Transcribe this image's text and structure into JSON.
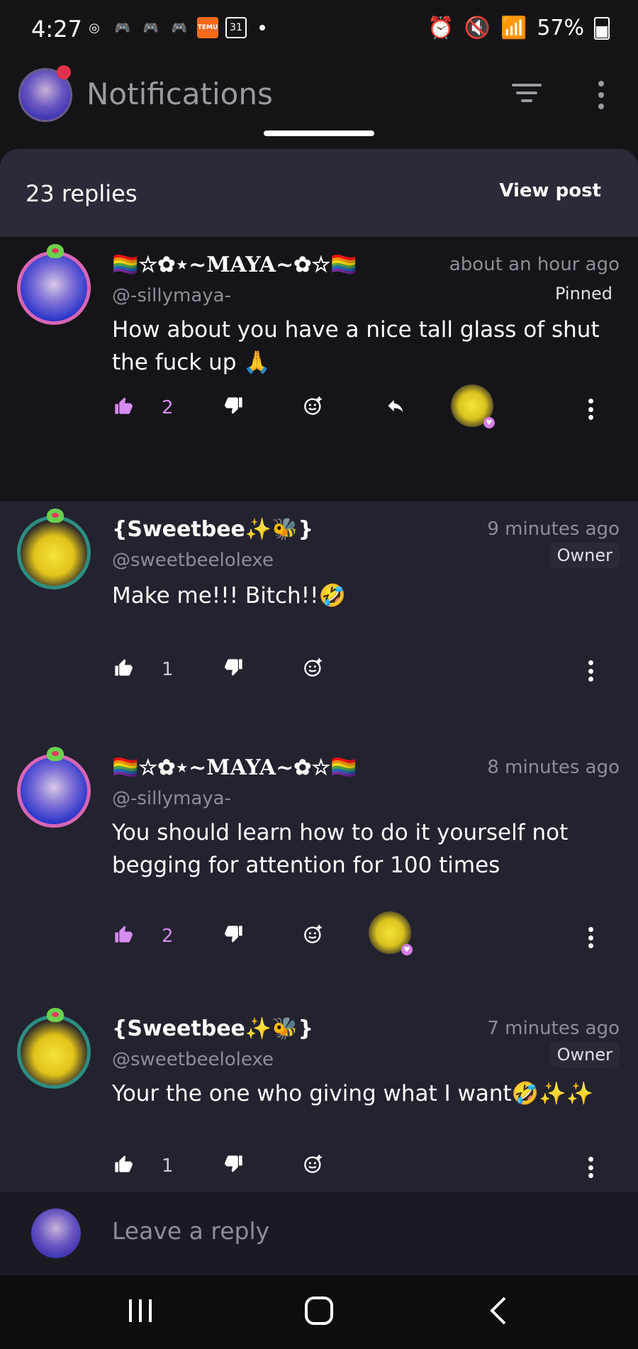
{
  "status_bar": {
    "time": "4:27",
    "battery": "57%",
    "calendar_day": "31",
    "temu_label": "TEMU"
  },
  "app_bar": {
    "title": "Notifications"
  },
  "thread": {
    "replies_count": "23 replies",
    "view_post_label": "View post"
  },
  "comments": [
    {
      "name": "🏳️‍🌈☆✿⋆~MAYA~✿☆🏳️‍🌈",
      "handle": "@-sillymaya-",
      "time": "about an hour ago",
      "tag": "Pinned",
      "text": "How about you have a nice tall glass of shut the fuck up 🙏",
      "likes": "2",
      "liked": true,
      "pinned": true
    },
    {
      "name": "{Sweetbee✨🐝}",
      "handle": "@sweetbeelolexe",
      "time": "9 minutes ago",
      "tag": "Owner",
      "text": "Make me!!! Bitch!!🤣",
      "likes": "1",
      "liked": false
    },
    {
      "name": "🏳️‍🌈☆✿⋆~MAYA~✿☆🏳️‍🌈",
      "handle": "@-sillymaya-",
      "time": "8 minutes ago",
      "tag": "",
      "text": "You should learn how to do it yourself not begging for attention for 100 times",
      "likes": "2",
      "liked": true
    },
    {
      "name": "{Sweetbee✨🐝}",
      "handle": "@sweetbeelolexe",
      "time": "7 minutes ago",
      "tag": "Owner",
      "text": "Your the one who giving what I want🤣✨✨",
      "likes": "1",
      "liked": false
    }
  ],
  "reply_bar": {
    "placeholder": "Leave a reply"
  },
  "colors": {
    "accent_like": "#d68cf0",
    "sheet_bg": "#23222f",
    "pinned_bg": "#151419"
  }
}
